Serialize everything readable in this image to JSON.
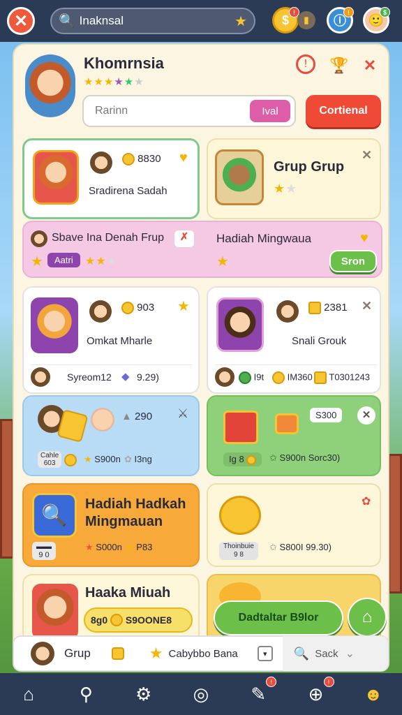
{
  "topbar": {
    "search_value": "Inaknsal",
    "icon_badge_1": "!",
    "icon_badge_2": "!",
    "icon_badge_3": "$"
  },
  "header": {
    "title": "Khomrnsia",
    "search_placeholder": "Rarinn",
    "search_button": "Ival",
    "action_button": "Cortienal"
  },
  "card1": {
    "score": "8830",
    "name": "Sradirena Sadah"
  },
  "card2": {
    "title": "Grup Grup"
  },
  "banner": {
    "left_title": "Sbave Ina Denah Frup",
    "tag": "Aatri",
    "right_title": "Hadiah Mingwaua",
    "button": "Sron"
  },
  "card3": {
    "score": "903",
    "name": "Omkat Mharle",
    "row_name": "Syreom12",
    "row_value": "9.29)"
  },
  "card4": {
    "score": "2381",
    "name": "Snali Grouk",
    "row_a": "I9t",
    "row_b": "IM360",
    "row_c": "T0301243"
  },
  "card5": {
    "score": "290",
    "tag": "Cahle",
    "tag_val": "603",
    "footer": "S900n",
    "footer2": "I3ng"
  },
  "card6": {
    "price": "S300",
    "lbl": "Ig 8",
    "footer": "S900n Sorc30)"
  },
  "card7": {
    "title": "Hadiah Hadkah Mingmauan",
    "tag": "9 0",
    "footer": "S000n",
    "footer2": "P83"
  },
  "card8": {
    "tag": "Thoinbuie",
    "tag_val": "9 8",
    "footer": "S800I 99.30)"
  },
  "card9": {
    "title": "Haaka Miuah",
    "pill_left": "8g0",
    "pill_right": "S9OONE8"
  },
  "card10": {
    "button": "Dadtaltar B9lor"
  },
  "bottom": {
    "left": "Grup",
    "mid": "Cabybbo Bana",
    "right": "Sack"
  },
  "nav": {
    "badge_a": "!",
    "badge_b": "!"
  }
}
